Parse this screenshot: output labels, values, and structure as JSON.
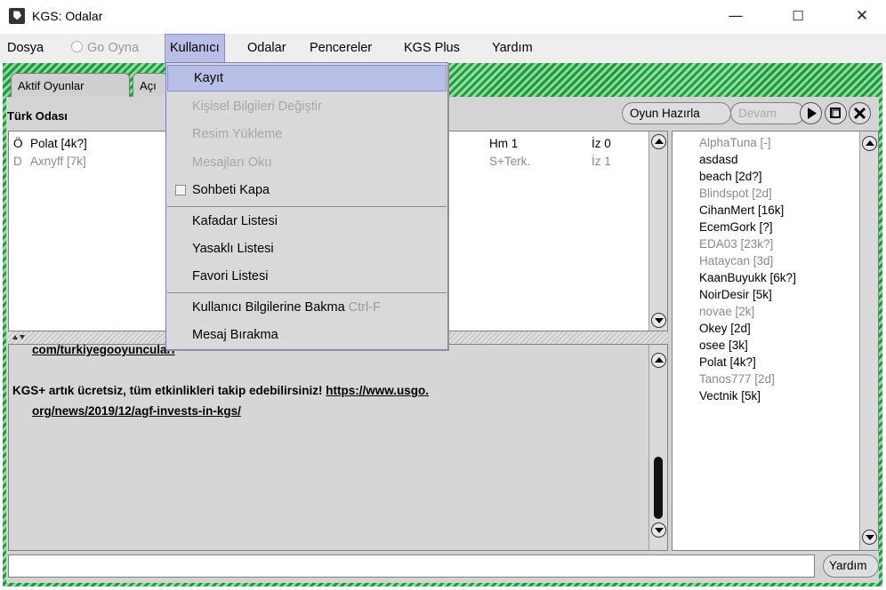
{
  "window": {
    "title": "KGS: Odalar",
    "minimize": "—",
    "maximize": "☐",
    "close": "✕"
  },
  "menubar": {
    "dosya": "Dosya",
    "go_oyna": "Go Oyna",
    "kullanici": "Kullanıcı",
    "odalar": "Odalar",
    "pencereler": "Pencereler",
    "kgs_plus": "KGS Plus",
    "yardim": "Yardım"
  },
  "tabs": {
    "aktif_oyunlar": "Aktif Oyunlar",
    "acik": "Açı"
  },
  "room": {
    "title": "Türk Odası",
    "oyun_hazirla": "Oyun Hazırla",
    "devam": "Devam"
  },
  "games": [
    {
      "flag": "Ö",
      "player": "Polat [4k?]",
      "status": "Hm 1",
      "info": "İz 0",
      "muted": false
    },
    {
      "flag": "D",
      "player": "Axnyff [7k]",
      "status": "S+Terk.",
      "info": "İz 1",
      "muted": true
    }
  ],
  "chat": {
    "line1": "com/turkiyegooyunculari",
    "line2_text": "KGS+ artık ücretsiz, tüm etkinlikleri takip edebilirsiniz! ",
    "line2_link": "https://www.usgo.",
    "line3_link": "org/news/2019/12/agf-invests-in-kgs/"
  },
  "users": [
    {
      "name": "AlphaTuna [-]",
      "muted": true
    },
    {
      "name": "asdasd",
      "muted": false
    },
    {
      "name": "beach [2d?]",
      "muted": false
    },
    {
      "name": "Blindspot [2d]",
      "muted": true
    },
    {
      "name": "CihanMert [16k]",
      "muted": false
    },
    {
      "name": "EcemGork [?]",
      "muted": false
    },
    {
      "name": "EDA03 [23k?]",
      "muted": true
    },
    {
      "name": "Hataycan [3d]",
      "muted": true
    },
    {
      "name": "KaanBuyukk [6k?]",
      "muted": false
    },
    {
      "name": "NoirDesir [5k]",
      "muted": false
    },
    {
      "name": "novae [2k]",
      "muted": true
    },
    {
      "name": "Okey [2d]",
      "muted": false
    },
    {
      "name": "osee [3k]",
      "muted": false
    },
    {
      "name": "Polat [4k?]",
      "muted": false
    },
    {
      "name": "Tanos777 [2d]",
      "muted": true
    },
    {
      "name": "Vectnik [5k]",
      "muted": false
    }
  ],
  "bottom": {
    "input_value": "",
    "yardim": "Yardım"
  },
  "dropdown": {
    "kayit": "Kayıt",
    "kisisel": "Kişisel Bilgileri Değiştir",
    "resim": "Resim Yükleme",
    "mesajlari_oku": "Mesajları Oku",
    "sohbeti_kapa": "Sohbeti Kapa",
    "kafadar": "Kafadar Listesi",
    "yasakli": "Yasaklı Listesi",
    "favori": "Favori Listesi",
    "bilgilerine_bakma": "Kullanıcı Bilgilerine Bakma",
    "bilgilerine_bakma_shortcut": "Ctrl-F",
    "mesaj_birakma": "Mesaj Bırakma"
  },
  "colors": {
    "frame_green": "#1d9a3e",
    "highlight": "#b8bfe6",
    "panel_gray": "#d4d4d4"
  }
}
